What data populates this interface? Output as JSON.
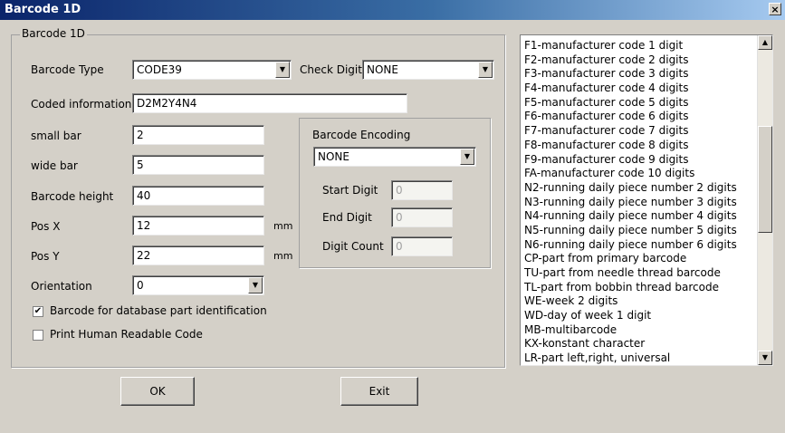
{
  "window": {
    "title": "Barcode 1D",
    "close_glyph": "×"
  },
  "group": {
    "title": "Barcode 1D"
  },
  "form": {
    "barcode_type_label": "Barcode Type",
    "barcode_type_value": "CODE39",
    "check_digit_label": "Check Digit",
    "check_digit_value": "NONE",
    "coded_info_label": "Coded information",
    "coded_info_value": "D2M2Y4N4",
    "small_bar_label": "small bar",
    "small_bar_value": "2",
    "wide_bar_label": "wide bar",
    "wide_bar_value": "5",
    "height_label": "Barcode height",
    "height_value": "40",
    "pos_x_label": "Pos X",
    "pos_x_value": "12",
    "pos_x_unit": "mm",
    "pos_y_label": "Pos Y",
    "pos_y_value": "22",
    "pos_y_unit": "mm",
    "orientation_label": "Orientation",
    "orientation_value": "0",
    "db_check_label": "Barcode for database part identification",
    "db_check_mark": "✔",
    "human_check_label": "Print Human Readable Code"
  },
  "encoding": {
    "title": "Barcode Encoding",
    "value": "NONE",
    "start_label": "Start Digit",
    "start_value": "0",
    "end_label": "End Digit",
    "end_value": "0",
    "count_label": "Digit Count",
    "count_value": "0"
  },
  "buttons": {
    "ok": "OK",
    "exit": "Exit"
  },
  "icons": {
    "dropdown": "▼",
    "scroll_up": "▲",
    "scroll_down": "▼"
  },
  "codes": [
    "F1-manufacturer code 1 digit",
    "F2-manufacturer code 2 digits",
    "F3-manufacturer code 3 digits",
    "F4-manufacturer code 4 digits",
    "F5-manufacturer code 5 digits",
    "F6-manufacturer code 6 digits",
    "F7-manufacturer code 7 digits",
    "F8-manufacturer code 8 digits",
    "F9-manufacturer code 9 digits",
    "FA-manufacturer code 10 digits",
    "N2-running daily piece number 2 digits",
    "N3-running daily piece number 3 digits",
    "N4-running daily piece number 4 digits",
    "N5-running daily piece number 5 digits",
    "N6-running daily piece number 6 digits",
    "CP-part from primary barcode",
    "TU-part from needle thread barcode",
    "TL-part from bobbin thread barcode",
    "WE-week 2 digits",
    "WD-day of week 1 digit",
    "MB-multibarcode",
    "KX-konstant character",
    "LR-part left,right, universal"
  ]
}
